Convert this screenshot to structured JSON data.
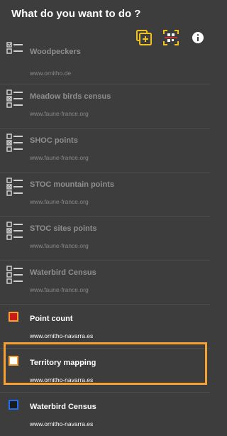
{
  "header": {
    "title": "What do you want to do ?",
    "actions": [
      {
        "icon": "add-copy-icon",
        "color": "#f0c020"
      },
      {
        "icon": "qr-scan-icon",
        "color": "#f0c020"
      },
      {
        "icon": "info-icon",
        "color": "#ffffff"
      }
    ]
  },
  "protocols": [
    {
      "title": "Woodpeckers",
      "site": "www.ornitho.de"
    },
    {
      "title": "Meadow birds census",
      "site": "www.faune-france.org"
    },
    {
      "title": "SHOC points",
      "site": "www.faune-france.org"
    },
    {
      "title": "STOC mountain points",
      "site": "www.faune-france.org"
    },
    {
      "title": "STOC sites points",
      "site": "www.faune-france.org"
    },
    {
      "title": "Waterbird Census",
      "site": "www.faune-france.org"
    }
  ],
  "site_protocols": [
    {
      "title": "Point count",
      "site": "www.ornitho-navarra.es",
      "border": "#f5a033",
      "fill": "#cc1a1a"
    },
    {
      "title": "Territory mapping",
      "site": "www.ornitho-navarra.es",
      "border": "#f5a033",
      "fill": "#ffffff"
    },
    {
      "title": "Waterbird Census",
      "site": "www.ornitho-navarra.es",
      "border": "#1e6ff0",
      "fill": "#1a1a1a"
    }
  ],
  "highlight_color": "#f5a033"
}
